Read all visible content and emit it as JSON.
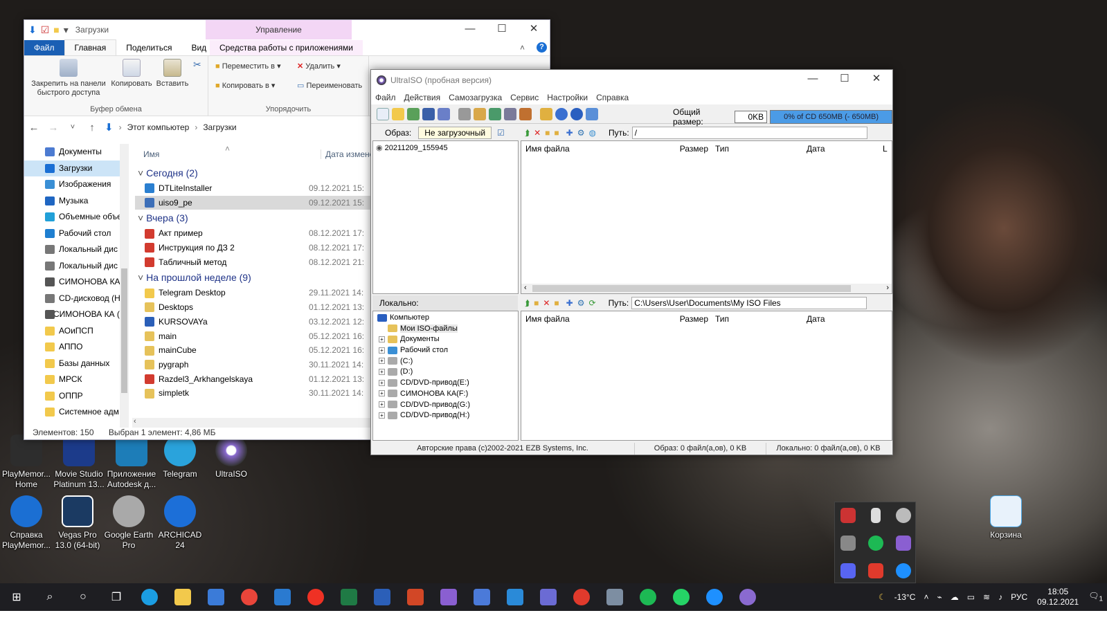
{
  "desktop": {
    "icons": [
      {
        "label": "PlayMemor... Home",
        "color": "#2d2d2d"
      },
      {
        "label": "Movie Studio Platinum 13...",
        "color": "#1c3b8a"
      },
      {
        "label": "Приложение Autodesk д...",
        "color": "#1d7db8"
      },
      {
        "label": "Telegram",
        "color": "#2aa3dc"
      },
      {
        "label": "UltraISO",
        "color": "#8a6ad0"
      },
      {
        "label": "Справка PlayMemor...",
        "color": "#1b6fd3"
      },
      {
        "label": "Vegas Pro 13.0 (64-bit)",
        "color": "#1b3a62"
      },
      {
        "label": "Google Earth Pro",
        "color": "#a9a9a9"
      },
      {
        "label": "ARCHICAD 24",
        "color": "#1c6fd8"
      },
      {
        "label": "Корзина",
        "color": "#4aa8e8"
      }
    ]
  },
  "explorer": {
    "quick_title": "Загрузки",
    "context_tab": "Управление",
    "tabs": [
      "Файл",
      "Главная",
      "Поделиться",
      "Вид"
    ],
    "context_subtab": "Средства работы с приложениями",
    "ribbon": {
      "pin": "Закрепить на панели быстрого доступа",
      "copy": "Копировать",
      "paste": "Вставить",
      "clipboard_group": "Буфер обмена",
      "move_to": "Переместить в",
      "copy_to": "Копировать в",
      "delete": "Удалить",
      "rename": "Переименовать",
      "organize_group": "Упорядочить"
    },
    "breadcrumb": [
      "Этот компьютер",
      "Загрузки"
    ],
    "nav": [
      {
        "label": "Документы",
        "color": "#4c7bd1"
      },
      {
        "label": "Загрузки",
        "color": "#1a6fd4",
        "selected": true
      },
      {
        "label": "Изображения",
        "color": "#3a8fd5"
      },
      {
        "label": "Музыка",
        "color": "#1f66c2"
      },
      {
        "label": "Объемные объе",
        "color": "#21a0d8"
      },
      {
        "label": "Рабочий стол",
        "color": "#1f7fd0"
      },
      {
        "label": "Локальный дис",
        "color": "#777"
      },
      {
        "label": "Локальный дис",
        "color": "#777"
      },
      {
        "label": "СИМОНОВА КА",
        "color": "#555"
      },
      {
        "label": "CD-дисковод (Н",
        "color": "#777"
      },
      {
        "label": "СИМОНОВА КА (",
        "color": "#555"
      },
      {
        "label": "АОиПСП",
        "color": "#f2c94c"
      },
      {
        "label": "АППО",
        "color": "#f2c94c"
      },
      {
        "label": "Базы данных",
        "color": "#f2c94c"
      },
      {
        "label": "МРСК",
        "color": "#f2c94c"
      },
      {
        "label": "ОППР",
        "color": "#f2c94c"
      },
      {
        "label": "Системное адм",
        "color": "#f2c94c"
      }
    ],
    "col_name": "Имя",
    "col_date": "Дата изменен",
    "groups": [
      {
        "title": "Сегодня (2)",
        "rows": [
          {
            "name": "DTLiteInstaller",
            "date": "09.12.2021 15:",
            "color": "#2a7fd0"
          },
          {
            "name": "uiso9_pe",
            "date": "09.12.2021 15:",
            "color": "#3d6fb8",
            "selected": true
          }
        ]
      },
      {
        "title": "Вчера (3)",
        "rows": [
          {
            "name": "Акт пример",
            "date": "08.12.2021 17:",
            "color": "#d23b2f"
          },
          {
            "name": "Инструкция по ДЗ 2",
            "date": "08.12.2021 17:",
            "color": "#d23b2f"
          },
          {
            "name": "Табличный метод",
            "date": "08.12.2021 21:",
            "color": "#d23b2f"
          }
        ]
      },
      {
        "title": "На прошлой неделе (9)",
        "rows": [
          {
            "name": "Telegram Desktop",
            "date": "29.11.2021 14:",
            "color": "#f2c94c"
          },
          {
            "name": "Desktops",
            "date": "01.12.2021 13:",
            "color": "#e6c25a"
          },
          {
            "name": "KURSOVAYa",
            "date": "03.12.2021 12:",
            "color": "#2b5fb8"
          },
          {
            "name": "main",
            "date": "05.12.2021 16:",
            "color": "#e6c25a"
          },
          {
            "name": "mainCube",
            "date": "05.12.2021 16:",
            "color": "#e6c25a"
          },
          {
            "name": "pygraph",
            "date": "30.11.2021 14:",
            "color": "#e6c25a"
          },
          {
            "name": "Razdel3_Arkhangelskaya",
            "date": "01.12.2021 13:",
            "color": "#d23b2f"
          },
          {
            "name": "simpletk",
            "date": "30.11.2021 14:",
            "color": "#e6c25a"
          }
        ]
      }
    ],
    "status_count": "Элементов: 150",
    "status_selected": "Выбран 1 элемент: 4,86 МБ"
  },
  "ultraiso": {
    "title": "UltraISO (пробная версия)",
    "menu": [
      "Файл",
      "Действия",
      "Самозагрузка",
      "Сервис",
      "Настройки",
      "Справка"
    ],
    "total_label": "Общий размер:",
    "total_value": "0KB",
    "capacity": "0% of CD 650MB (- 650MB)",
    "image_label": "Образ:",
    "image_type": "Не загрузочный",
    "path_label": "Путь:",
    "image_path": "/",
    "image_root": "20211209_155945",
    "cols": {
      "name": "Имя файла",
      "size": "Размер",
      "type": "Тип",
      "date": "Дата",
      "extra": "L"
    },
    "local_label": "Локально:",
    "local_path": "C:\\Users\\User\\Documents\\My ISO Files",
    "tree": [
      {
        "label": "Компьютер",
        "color": "#2a5fc0",
        "level": 0
      },
      {
        "label": "Мои ISO-файлы",
        "color": "#e6c25a",
        "level": 1
      },
      {
        "label": "Документы",
        "color": "#e6c25a",
        "level": 1,
        "plus": true
      },
      {
        "label": "Рабочий стол",
        "color": "#3a8fd5",
        "level": 1,
        "plus": true
      },
      {
        "label": "(C:)",
        "color": "#aaa",
        "level": 1,
        "plus": true
      },
      {
        "label": "(D:)",
        "color": "#aaa",
        "level": 1,
        "plus": true
      },
      {
        "label": "CD/DVD-привод(E:)",
        "color": "#aaa",
        "level": 1,
        "plus": true
      },
      {
        "label": "СИМОНОВА КА(F:)",
        "color": "#aaa",
        "level": 1,
        "plus": true
      },
      {
        "label": "CD/DVD-привод(G:)",
        "color": "#aaa",
        "level": 1,
        "plus": true
      },
      {
        "label": "CD/DVD-привод(H:)",
        "color": "#aaa",
        "level": 1,
        "plus": true
      }
    ],
    "status_copyright": "Авторские права (c)2002-2021 EZB Systems, Inc.",
    "status_image": "Образ: 0 файл(а,ов), 0 KB",
    "status_local": "Локально: 0 файл(а,ов), 0 KB"
  },
  "taskbar": {
    "apps": [
      {
        "name": "edge-icon",
        "color": "#1b9de2"
      },
      {
        "name": "file-explorer-icon",
        "color": "#f2c94c"
      },
      {
        "name": "store-icon",
        "color": "#3b7bd8"
      },
      {
        "name": "chrome-icon",
        "color": "#e9453a"
      },
      {
        "name": "mail-icon",
        "color": "#2a7ad0"
      },
      {
        "name": "yandex-icon",
        "color": "#ef3124"
      },
      {
        "name": "excel-icon",
        "color": "#1f7a45"
      },
      {
        "name": "word-icon",
        "color": "#2b5fb8"
      },
      {
        "name": "powerpoint-icon",
        "color": "#d24726"
      },
      {
        "name": "visual-studio-icon",
        "color": "#8a5fd1"
      },
      {
        "name": "security-icon",
        "color": "#4b7ad9"
      },
      {
        "name": "archicad-icon",
        "color": "#2a8ad8"
      },
      {
        "name": "teams-icon",
        "color": "#6b6bd4"
      },
      {
        "name": "opera-icon",
        "color": "#e03a2c"
      },
      {
        "name": "photo-icon",
        "color": "#7d8ea2"
      },
      {
        "name": "spotify-icon",
        "color": "#1db954"
      },
      {
        "name": "whatsapp-icon",
        "color": "#25d366"
      },
      {
        "name": "bolt-icon",
        "color": "#1e90ff"
      },
      {
        "name": "ultraiso-icon",
        "color": "#8a6ad0"
      }
    ],
    "temperature": "-13°C",
    "lang": "РУС",
    "time": "18:05",
    "date": "09.12.2021",
    "notif": "1"
  }
}
